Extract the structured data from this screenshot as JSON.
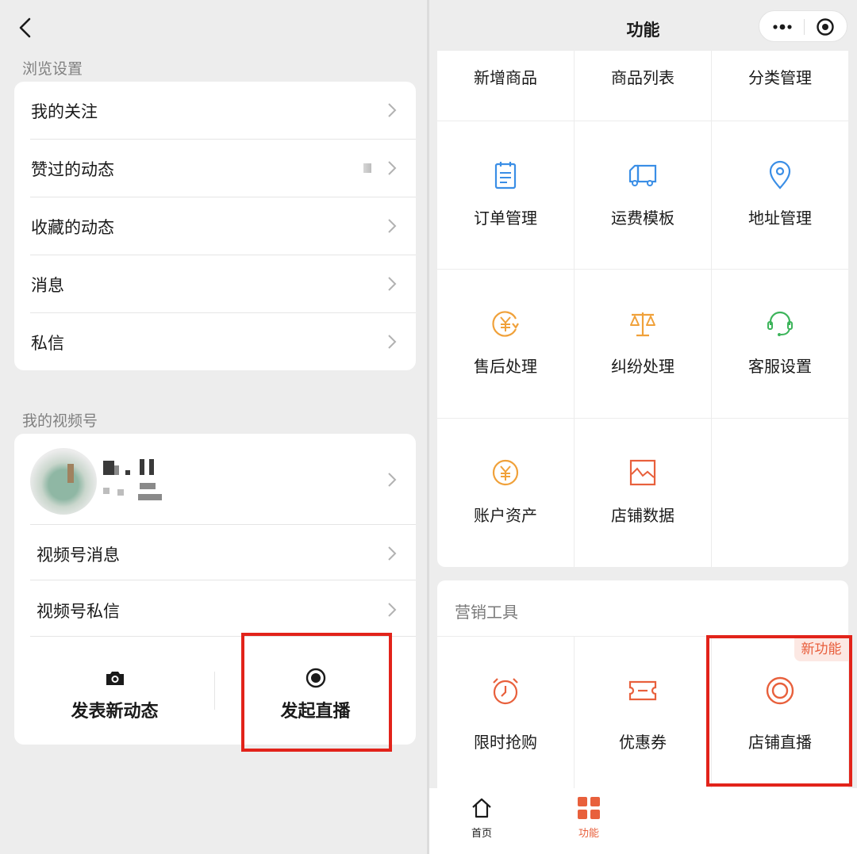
{
  "left": {
    "browse_section_label": "浏览设置",
    "browse_items": [
      {
        "label": "我的关注"
      },
      {
        "label": "赞过的动态"
      },
      {
        "label": "收藏的动态"
      },
      {
        "label": "消息"
      },
      {
        "label": "私信"
      }
    ],
    "channel_section_label": "我的视频号",
    "channel_items": [
      {
        "label": "视频号消息"
      },
      {
        "label": "视频号私信"
      }
    ],
    "actions": {
      "post_label": "发表新动态",
      "live_label": "发起直播"
    }
  },
  "right": {
    "header_title": "功能",
    "grid": [
      {
        "label": "新增商品",
        "icon": "none"
      },
      {
        "label": "商品列表",
        "icon": "none"
      },
      {
        "label": "分类管理",
        "icon": "none"
      },
      {
        "label": "订单管理",
        "icon": "clipboard-icon"
      },
      {
        "label": "运费模板",
        "icon": "truck-icon"
      },
      {
        "label": "地址管理",
        "icon": "location-pin-icon"
      },
      {
        "label": "售后处理",
        "icon": "yuan-refund-icon"
      },
      {
        "label": "纠纷处理",
        "icon": "scale-icon"
      },
      {
        "label": "客服设置",
        "icon": "headset-icon"
      },
      {
        "label": "账户资产",
        "icon": "yuan-coin-icon"
      },
      {
        "label": "店铺数据",
        "icon": "chart-icon"
      }
    ],
    "marketing": {
      "title": "营销工具",
      "new_badge": "新功能",
      "items": [
        {
          "label": "限时抢购",
          "icon": "alarm-clock-icon"
        },
        {
          "label": "优惠券",
          "icon": "coupon-icon"
        },
        {
          "label": "店铺直播",
          "icon": "live-ring-icon"
        }
      ]
    },
    "tabbar": [
      {
        "label": "首页",
        "icon": "home-icon",
        "color": "#1a1a1a"
      },
      {
        "label": "功能",
        "icon": "grid-icon",
        "color": "#e8603c"
      }
    ]
  },
  "colors": {
    "blue": "#3a8ee6",
    "orange": "#f0a13a",
    "green": "#3cb45a",
    "accent": "#e8603c",
    "highlight": "#e2231a"
  }
}
